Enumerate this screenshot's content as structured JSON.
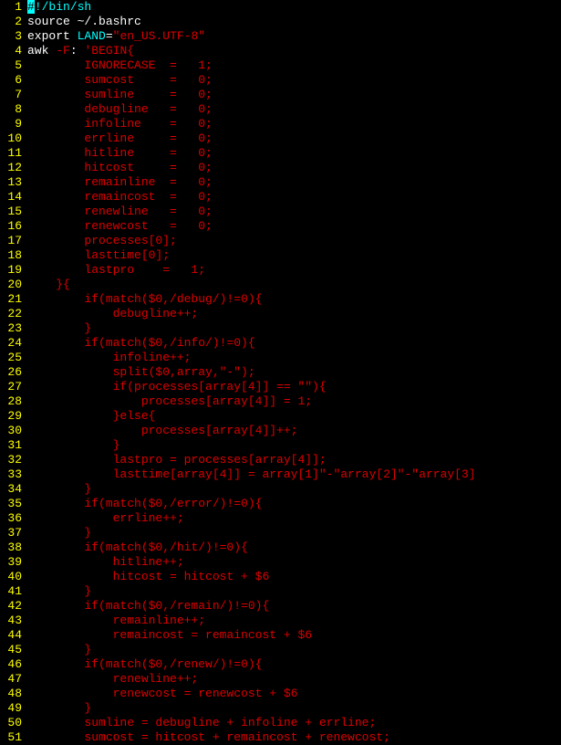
{
  "lines": [
    {
      "n": "1",
      "segs": [
        {
          "t": "#",
          "c": "cursor"
        },
        {
          "t": "!/bin/sh",
          "c": "cyan"
        }
      ]
    },
    {
      "n": "2",
      "segs": [
        {
          "t": "source ~/.bashrc",
          "c": "white"
        }
      ]
    },
    {
      "n": "3",
      "segs": [
        {
          "t": "export",
          "c": "white"
        },
        {
          "t": " ",
          "c": "white"
        },
        {
          "t": "LAND",
          "c": "cyan"
        },
        {
          "t": "=",
          "c": "white"
        },
        {
          "t": "\"en_US.UTF-8\"",
          "c": "red"
        }
      ]
    },
    {
      "n": "4",
      "segs": [
        {
          "t": "awk ",
          "c": "white"
        },
        {
          "t": "-F",
          "c": "red"
        },
        {
          "t": ": ",
          "c": "white"
        },
        {
          "t": "'BEGIN{",
          "c": "red"
        }
      ]
    },
    {
      "n": "5",
      "segs": [
        {
          "t": "        IGNORECASE  =   1;",
          "c": "red"
        }
      ]
    },
    {
      "n": "6",
      "segs": [
        {
          "t": "        sumcost     =   0;",
          "c": "red"
        }
      ]
    },
    {
      "n": "7",
      "segs": [
        {
          "t": "        sumline     =   0;",
          "c": "red"
        }
      ]
    },
    {
      "n": "8",
      "segs": [
        {
          "t": "        debugline   =   0;",
          "c": "red"
        }
      ]
    },
    {
      "n": "9",
      "segs": [
        {
          "t": "        infoline    =   0;",
          "c": "red"
        }
      ]
    },
    {
      "n": "10",
      "segs": [
        {
          "t": "        errline     =   0;",
          "c": "red"
        }
      ]
    },
    {
      "n": "11",
      "segs": [
        {
          "t": "        hitline     =   0;",
          "c": "red"
        }
      ]
    },
    {
      "n": "12",
      "segs": [
        {
          "t": "        hitcost     =   0;",
          "c": "red"
        }
      ]
    },
    {
      "n": "13",
      "segs": [
        {
          "t": "        remainline  =   0;",
          "c": "red"
        }
      ]
    },
    {
      "n": "14",
      "segs": [
        {
          "t": "        remaincost  =   0;",
          "c": "red"
        }
      ]
    },
    {
      "n": "15",
      "segs": [
        {
          "t": "        renewline   =   0;",
          "c": "red"
        }
      ]
    },
    {
      "n": "16",
      "segs": [
        {
          "t": "        renewcost   =   0;",
          "c": "red"
        }
      ]
    },
    {
      "n": "17",
      "segs": [
        {
          "t": "        processes[0];",
          "c": "red"
        }
      ]
    },
    {
      "n": "18",
      "segs": [
        {
          "t": "        lasttime[0];",
          "c": "red"
        }
      ]
    },
    {
      "n": "19",
      "segs": [
        {
          "t": "        lastpro    =   1;",
          "c": "red"
        }
      ]
    },
    {
      "n": "20",
      "segs": [
        {
          "t": "    }{",
          "c": "red"
        }
      ]
    },
    {
      "n": "21",
      "segs": [
        {
          "t": "        if(match($0,/debug/)!=0){",
          "c": "red"
        }
      ]
    },
    {
      "n": "22",
      "segs": [
        {
          "t": "            debugline++;",
          "c": "red"
        }
      ]
    },
    {
      "n": "23",
      "segs": [
        {
          "t": "        }",
          "c": "red"
        }
      ]
    },
    {
      "n": "24",
      "segs": [
        {
          "t": "        if(match($0,/info/)!=0){",
          "c": "red"
        }
      ]
    },
    {
      "n": "25",
      "segs": [
        {
          "t": "            infoline++;",
          "c": "red"
        }
      ]
    },
    {
      "n": "26",
      "segs": [
        {
          "t": "            split($0,array,\"-\");",
          "c": "red"
        }
      ]
    },
    {
      "n": "27",
      "segs": [
        {
          "t": "            if(processes[array[4]] == \"\"){",
          "c": "red"
        }
      ]
    },
    {
      "n": "28",
      "segs": [
        {
          "t": "                processes[array[4]] = 1;",
          "c": "red"
        }
      ]
    },
    {
      "n": "29",
      "segs": [
        {
          "t": "            }else{",
          "c": "red"
        }
      ]
    },
    {
      "n": "30",
      "segs": [
        {
          "t": "                processes[array[4]]++;",
          "c": "red"
        }
      ]
    },
    {
      "n": "31",
      "segs": [
        {
          "t": "            }",
          "c": "red"
        }
      ]
    },
    {
      "n": "32",
      "segs": [
        {
          "t": "            lastpro = processes[array[4]];",
          "c": "red"
        }
      ]
    },
    {
      "n": "33",
      "segs": [
        {
          "t": "            lasttime[array[4]] = array[1]\"-\"array[2]\"-\"array[3]",
          "c": "red"
        }
      ]
    },
    {
      "n": "34",
      "segs": [
        {
          "t": "        }",
          "c": "red"
        }
      ]
    },
    {
      "n": "35",
      "segs": [
        {
          "t": "        if(match($0,/error/)!=0){",
          "c": "red"
        }
      ]
    },
    {
      "n": "36",
      "segs": [
        {
          "t": "            errline++;",
          "c": "red"
        }
      ]
    },
    {
      "n": "37",
      "segs": [
        {
          "t": "        }",
          "c": "red"
        }
      ]
    },
    {
      "n": "38",
      "segs": [
        {
          "t": "        if(match($0,/hit/)!=0){",
          "c": "red"
        }
      ]
    },
    {
      "n": "39",
      "segs": [
        {
          "t": "            hitline++;",
          "c": "red"
        }
      ]
    },
    {
      "n": "40",
      "segs": [
        {
          "t": "            hitcost = hitcost + $6",
          "c": "red"
        }
      ]
    },
    {
      "n": "41",
      "segs": [
        {
          "t": "        }",
          "c": "red"
        }
      ]
    },
    {
      "n": "42",
      "segs": [
        {
          "t": "        if(match($0,/remain/)!=0){",
          "c": "red"
        }
      ]
    },
    {
      "n": "43",
      "segs": [
        {
          "t": "            remainline++;",
          "c": "red"
        }
      ]
    },
    {
      "n": "44",
      "segs": [
        {
          "t": "            remaincost = remaincost + $6",
          "c": "red"
        }
      ]
    },
    {
      "n": "45",
      "segs": [
        {
          "t": "        }",
          "c": "red"
        }
      ]
    },
    {
      "n": "46",
      "segs": [
        {
          "t": "        if(match($0,/renew/)!=0){",
          "c": "red"
        }
      ]
    },
    {
      "n": "47",
      "segs": [
        {
          "t": "            renewline++;",
          "c": "red"
        }
      ]
    },
    {
      "n": "48",
      "segs": [
        {
          "t": "            renewcost = renewcost + $6",
          "c": "red"
        }
      ]
    },
    {
      "n": "49",
      "segs": [
        {
          "t": "        }",
          "c": "red"
        }
      ]
    },
    {
      "n": "50",
      "segs": [
        {
          "t": "        sumline = debugline + infoline + errline;",
          "c": "red"
        }
      ]
    },
    {
      "n": "51",
      "segs": [
        {
          "t": "        sumcost = hitcost + remaincost + renewcost;",
          "c": "red"
        }
      ]
    }
  ]
}
